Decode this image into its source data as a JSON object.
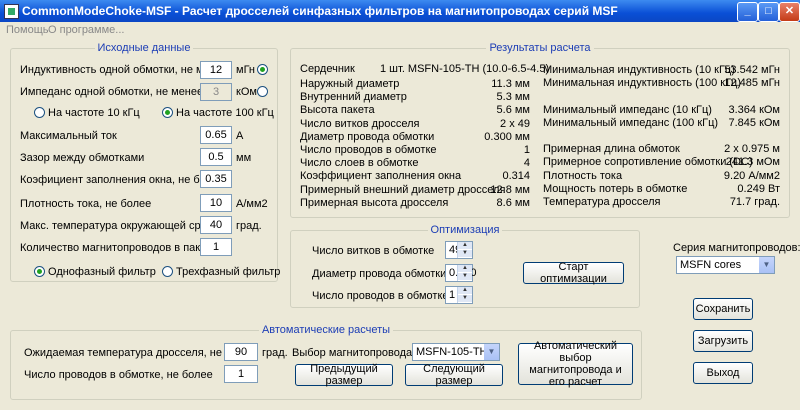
{
  "window": {
    "title": "CommonModeChoke-MSF  -  Расчет дросселей синфазных фильтров на магнитопроводах серий MSF",
    "min": "_",
    "max": "□",
    "close": "✕"
  },
  "menu": [
    "Помощь",
    "О программе..."
  ],
  "input": {
    "legend": "Исходные данные",
    "inductance_label": "Индуктивность одной обмотки, не менее",
    "inductance_value": "12",
    "inductance_unit": "мГн",
    "impedance_label": "Импеданс одной обмотки, не менее",
    "impedance_value": "3",
    "impedance_unit": "кОм",
    "freq10_label": "На частоте 10 кГц",
    "freq100_label": "На частоте 100 кГц",
    "max_current_label": "Максимальный ток",
    "max_current_value": "0.65",
    "max_current_unit": "А",
    "gap_label": "Зазор между обмотками",
    "gap_value": "0.5",
    "gap_unit": "мм",
    "fill_label": "Коэфициент заполнения окна, не более",
    "fill_value": "0.35",
    "density_label": "Плотность тока, не более",
    "density_value": "10",
    "density_unit": "А/мм2",
    "ambient_label": "Макс. температура окружающей среды",
    "ambient_value": "40",
    "ambient_unit": "град.",
    "cores_label": "Количество магнитопроводов  в пакете",
    "cores_value": "1",
    "single_phase": "Однофазный фильтр",
    "three_phase": "Трехфазный фильтр"
  },
  "results": {
    "legend": "Результаты расчета",
    "core_label": "Сердечник",
    "core_value": "1 шт. MSFN-105-TH (10.0-6.5-4.5)",
    "left": [
      {
        "label": "Наружный диаметр",
        "value": "11.3 мм"
      },
      {
        "label": "Внутренний диаметр",
        "value": "5.3 мм"
      },
      {
        "label": "Высота пакета",
        "value": "5.6 мм"
      },
      {
        "label": "Число витков дросселя",
        "value": "2 х 49"
      },
      {
        "label": "Диаметр провода обмотки",
        "value": "0.300 мм"
      },
      {
        "label": "Число проводов в обмотке",
        "value": "1"
      },
      {
        "label": "Число слоев в обмотке",
        "value": "4"
      },
      {
        "label": "Коэффициент заполнения окна",
        "value": "0.314"
      },
      {
        "label": "Примерный внешний диаметр дросселя",
        "value": "12.8 мм"
      },
      {
        "label": "Примерная высота дросселя",
        "value": "8.6 мм"
      }
    ],
    "right": [
      {
        "label": "Минимальная индуктивность (10 кГц)",
        "value": "53.542  мГн"
      },
      {
        "label": "Минимальная индуктивность (100 кГц)",
        "value": "12.485 мГн"
      },
      {
        "label": "",
        "value": ""
      },
      {
        "label": "Минимальный импеданс (10 кГц)",
        "value": "3.364 кОм"
      },
      {
        "label": "Минимальный импеданс (100 кГц)",
        "value": "7.845 кОм"
      },
      {
        "label": "",
        "value": ""
      },
      {
        "label": "Примерная длина обмоток",
        "value": "2 х 0.975 м"
      },
      {
        "label": "Примерное сопротивление обмотки (DC)",
        "value": "241.3 мОм"
      },
      {
        "label": "Плотность тока",
        "value": "9.20 А/мм2"
      },
      {
        "label": "Мощность потерь в обмотке",
        "value": "0.249 Вт"
      },
      {
        "label": "Температура дросселя",
        "value": "71.7 град."
      }
    ]
  },
  "optimization": {
    "legend": "Оптимизация",
    "turns_label": "Число витков в обмотке",
    "turns_value": "49",
    "wire_label": "Диаметр провода обмотки, мм",
    "wire_value": "0.300",
    "wires_label": "Число проводов в обмотке",
    "wires_value": "1",
    "start_button": "Старт оптимизации"
  },
  "series": {
    "label": "Серия магнитопроводов:",
    "value": "MSFN cores"
  },
  "auto": {
    "legend": "Автоматические расчеты",
    "temp_label": "Ожидаемая температура дросселя, не более",
    "temp_value": "90",
    "temp_unit": "град.",
    "wires_label": "Число проводов в обмотке, не более",
    "wires_value": "1",
    "core_select_label": "Выбор магнитопровода:",
    "core_select_value": "MSFN-105-TH",
    "prev_button": "Предыдущий размер",
    "next_button": "Следующий размер",
    "auto_button": "Автоматический выбор магнитопровода и его расчет"
  },
  "buttons": {
    "save": "Сохранить",
    "load": "Загрузить",
    "exit": "Выход"
  }
}
